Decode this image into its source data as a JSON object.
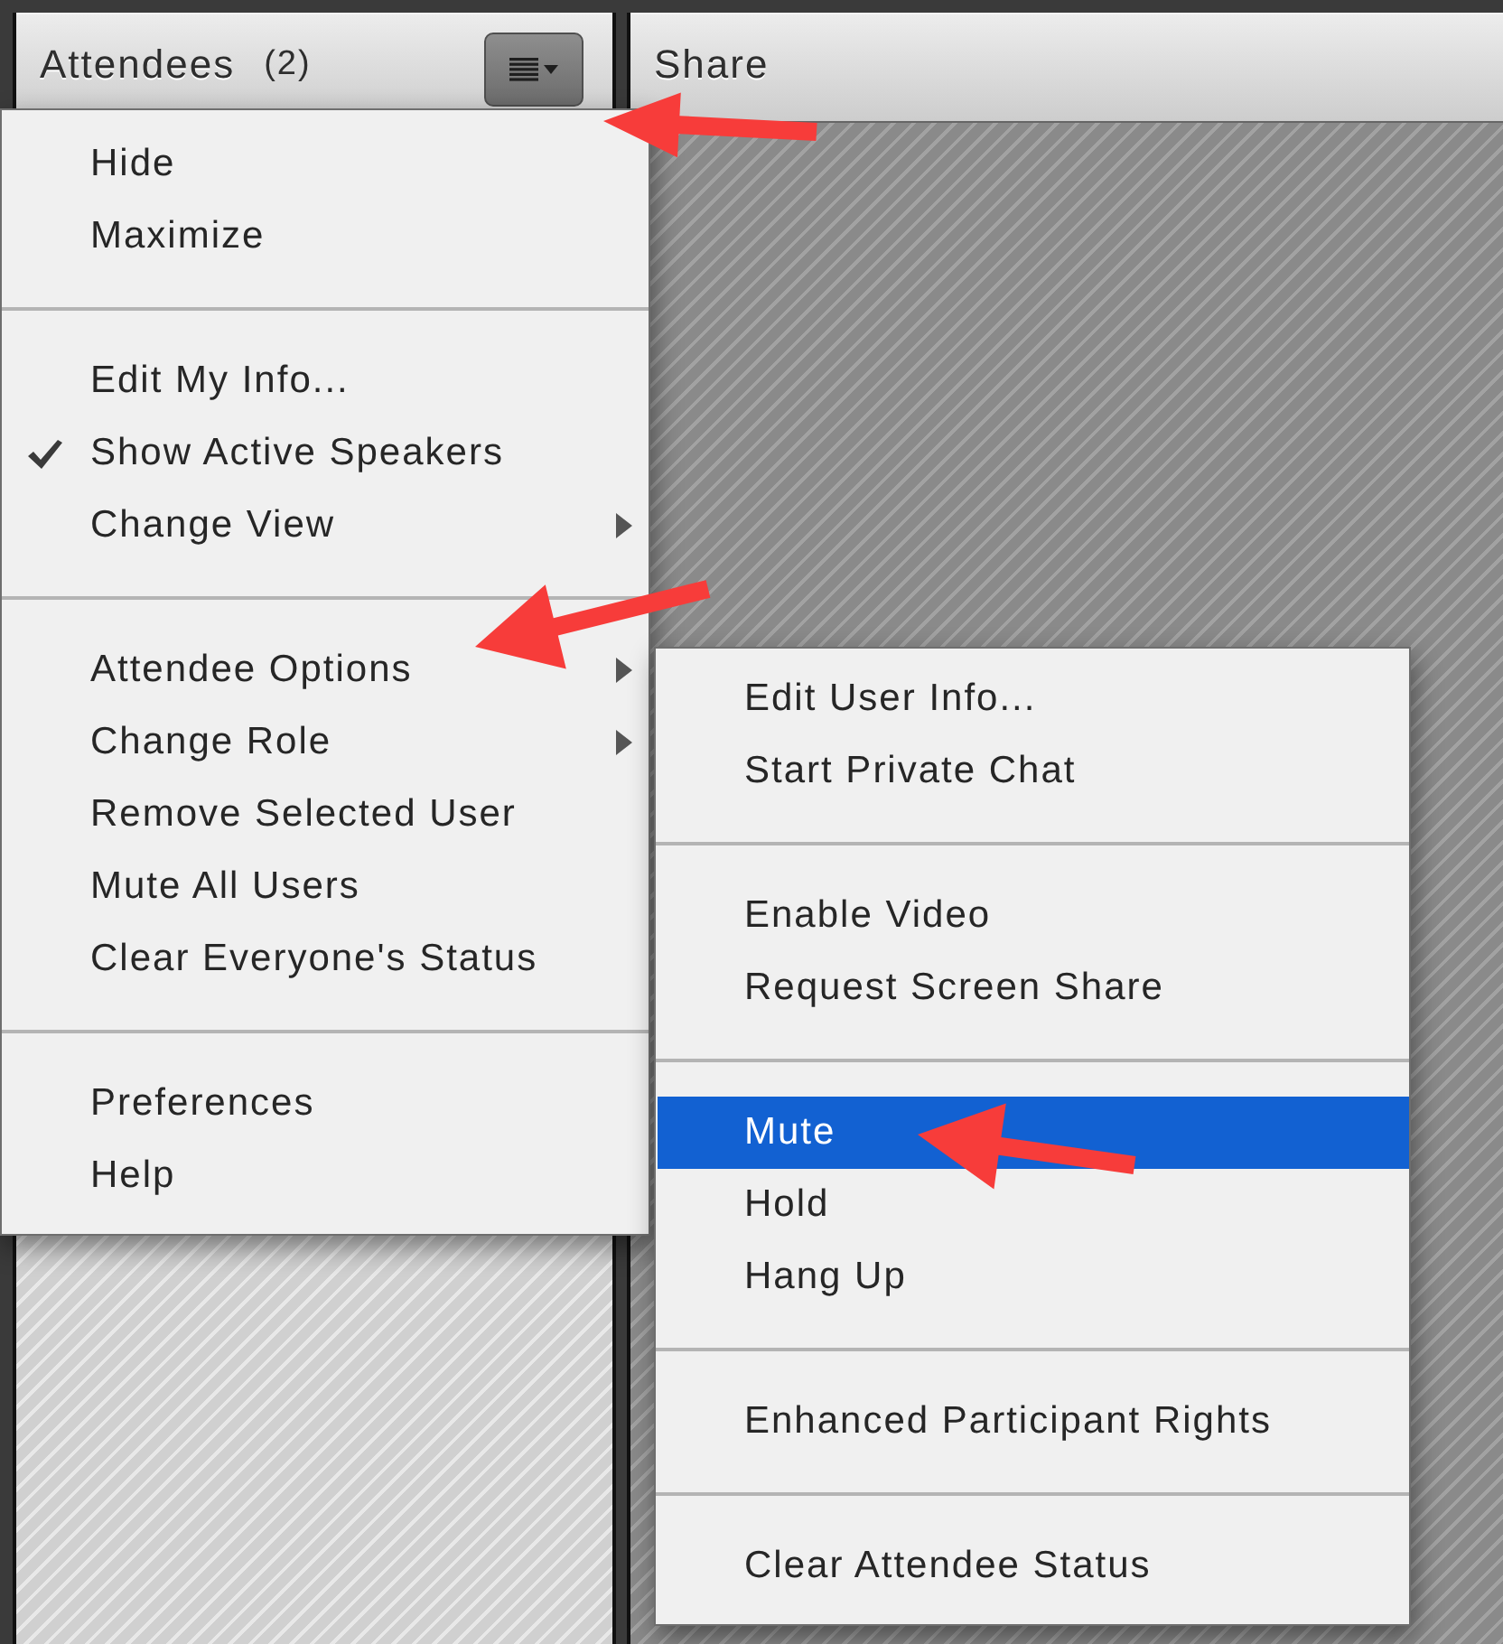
{
  "attendees_pod": {
    "title": "Attendees",
    "count": "(2)"
  },
  "share_pod": {
    "title": "Share"
  },
  "pod_menu": {
    "groups": [
      {
        "items": [
          {
            "label": "Hide",
            "checked": false,
            "has_submenu": false
          },
          {
            "label": "Maximize",
            "checked": false,
            "has_submenu": false
          }
        ]
      },
      {
        "items": [
          {
            "label": "Edit My Info...",
            "checked": false,
            "has_submenu": false
          },
          {
            "label": "Show Active Speakers",
            "checked": true,
            "has_submenu": false
          },
          {
            "label": "Change View",
            "checked": false,
            "has_submenu": true
          }
        ]
      },
      {
        "items": [
          {
            "label": "Attendee Options",
            "checked": false,
            "has_submenu": true
          },
          {
            "label": "Change Role",
            "checked": false,
            "has_submenu": true
          },
          {
            "label": "Remove Selected User",
            "checked": false,
            "has_submenu": false
          },
          {
            "label": "Mute All Users",
            "checked": false,
            "has_submenu": false
          },
          {
            "label": "Clear Everyone's Status",
            "checked": false,
            "has_submenu": false
          }
        ]
      },
      {
        "items": [
          {
            "label": "Preferences",
            "checked": false,
            "has_submenu": false
          },
          {
            "label": "Help",
            "checked": false,
            "has_submenu": false
          }
        ]
      }
    ]
  },
  "attendee_options_submenu": {
    "groups": [
      {
        "items": [
          {
            "label": "Edit User Info...",
            "selected": false
          },
          {
            "label": "Start Private Chat",
            "selected": false
          }
        ]
      },
      {
        "items": [
          {
            "label": "Enable Video",
            "selected": false
          },
          {
            "label": "Request Screen Share",
            "selected": false
          }
        ]
      },
      {
        "items": [
          {
            "label": "Mute",
            "selected": true
          },
          {
            "label": "Hold",
            "selected": false
          },
          {
            "label": "Hang Up",
            "selected": false
          }
        ]
      },
      {
        "items": [
          {
            "label": "Enhanced Participant Rights",
            "selected": false
          }
        ]
      },
      {
        "items": [
          {
            "label": "Clear Attendee Status",
            "selected": false
          }
        ]
      }
    ]
  }
}
